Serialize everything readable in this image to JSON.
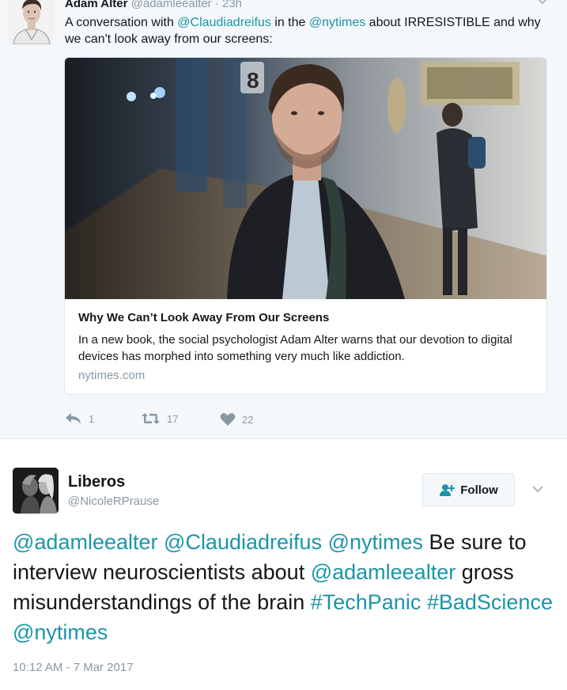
{
  "parent_tweet": {
    "author_name": "Adam Alter",
    "author_handle": "@adamleealter",
    "separator": " · ",
    "time": "23h",
    "text_parts": [
      {
        "t": "A conversation with ",
        "link": false
      },
      {
        "t": "@Claudiadreifus",
        "link": true
      },
      {
        "t": " in the ",
        "link": false
      },
      {
        "t": "@nytimes",
        "link": true
      },
      {
        "t": " about IRRESISTIBLE and why we can't look away from our screens:",
        "link": false
      }
    ],
    "card": {
      "title": "Why We Can’t Look Away From Our Screens",
      "description": "In a new book, the social psychologist Adam Alter warns that our devotion to digital devices has morphed into something very much like addiction.",
      "domain": "nytimes.com",
      "image_sign_text": "8"
    },
    "actions": {
      "reply_count": "1",
      "retweet_count": "17",
      "like_count": "22"
    }
  },
  "main_tweet": {
    "author_name": "Liberos",
    "author_handle": "@NicoleRPrause",
    "follow_label": "Follow",
    "text_parts": [
      {
        "t": "@adamleealter",
        "link": true
      },
      {
        "t": " ",
        "link": false
      },
      {
        "t": "@Claudiadreifus",
        "link": true
      },
      {
        "t": " ",
        "link": false
      },
      {
        "t": "@nytimes",
        "link": true
      },
      {
        "t": " Be sure to interview neuroscientists about ",
        "link": false
      },
      {
        "t": "@adamleealter",
        "link": true
      },
      {
        "t": " gross misunderstandings of the brain ",
        "link": false
      },
      {
        "t": "#TechPanic",
        "link": true
      },
      {
        "t": " ",
        "link": false
      },
      {
        "t": "#BadScience",
        "link": true
      },
      {
        "t": " ",
        "link": false
      },
      {
        "t": "@nytimes",
        "link": true
      }
    ],
    "timestamp": "10:12 AM - 7 Mar 2017"
  },
  "colors": {
    "link": "#1b95a8",
    "muted": "#8899a6",
    "text": "#14171a",
    "parent_bg": "#f5f8fa"
  }
}
